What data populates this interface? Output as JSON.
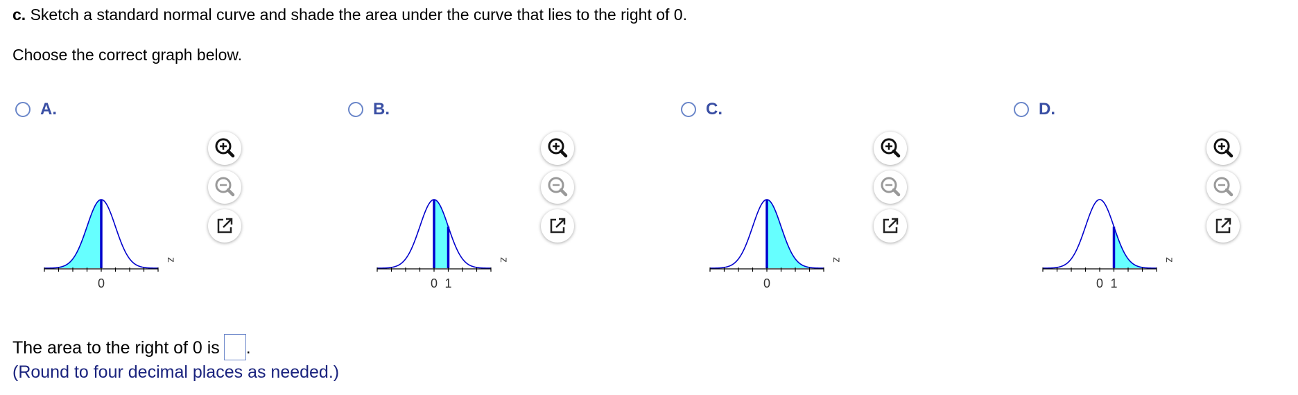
{
  "question": {
    "label": "c.",
    "text": " Sketch a standard normal curve and shade the area under the curve that lies to the right of 0."
  },
  "instruction": "Choose the correct graph below.",
  "options": [
    {
      "label": "A.",
      "shade": "left",
      "lines": [
        0
      ],
      "ticks": [
        "0"
      ]
    },
    {
      "label": "B.",
      "shade": "0to1",
      "lines": [
        0,
        1
      ],
      "ticks": [
        "0",
        "1"
      ]
    },
    {
      "label": "C.",
      "shade": "right",
      "lines": [
        0
      ],
      "ticks": [
        "0"
      ]
    },
    {
      "label": "D.",
      "shade": "right1",
      "lines": [
        1
      ],
      "ticks": [
        "0",
        "1"
      ]
    }
  ],
  "axis_label": "z",
  "answer": {
    "prefix": "The area to the right of 0 is",
    "suffix": ".",
    "value": ""
  },
  "hint": "(Round to four decimal places as needed.)",
  "icons": {
    "zoom_in": "zoom-in-icon",
    "zoom_out": "zoom-out-icon",
    "popout": "popout-icon"
  },
  "colors": {
    "curve": "#0000cc",
    "shade": "#66ffff",
    "accent": "#3a4fa4",
    "radio": "#6a86c9",
    "hint": "#1a237e"
  }
}
